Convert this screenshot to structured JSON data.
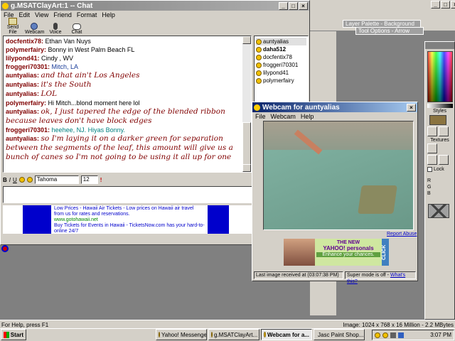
{
  "chat": {
    "title": "g.MSATClayArt:1 -- Chat",
    "menu": [
      "File",
      "Edit",
      "View",
      "Friend",
      "Format",
      "Help"
    ],
    "toolbar": [
      "Send File",
      "Webcam",
      "Voice",
      "Chat"
    ],
    "messages": [
      {
        "name": "docfentix78:",
        "text": "Ethan Van Nuys",
        "style": "plain"
      },
      {
        "name": "polymerfairy:",
        "text": "Bonny in West Palm Beach FL",
        "style": "plain"
      },
      {
        "name": "lilypond41:",
        "text": "Cindy , WV",
        "style": "plain"
      },
      {
        "name": "froggeri70301:",
        "text": "Mitch, LA",
        "style": "green"
      },
      {
        "name": "auntyalias:",
        "text": "and that ain't Los Angeles",
        "style": "script"
      },
      {
        "name": "auntyalias:",
        "text": "it's the South",
        "style": "script"
      },
      {
        "name": "auntyalias:",
        "text": "LOL",
        "style": "script"
      },
      {
        "name": "polymerfairy:",
        "text": "Hi Mitch...blond moment here lol",
        "style": "plain"
      },
      {
        "name": "auntyalias:",
        "text": "ok, I just tapered the edge of the blended ribbon because leaves don't have block edges",
        "style": "script"
      },
      {
        "name": "froggeri70301:",
        "text": "heehee, NJ. Hiyas Bonny.",
        "style": "green"
      },
      {
        "name": "auntyalias:",
        "text": "so I'm laying it on a darker green for separation between the segments of the leaf, this amount will give us a bunch of canes so I'm not going to be using it all up for one",
        "style": "script"
      }
    ],
    "users": [
      "auntyalias",
      "daha512",
      "docfentix78",
      "froggeri70301",
      "lilypond41",
      "polymerfairy"
    ],
    "font": "Tahoma",
    "size": "12",
    "ads": [
      "Low Prices - Hawaii Air Tickets - Low prices on Hawaii air travel from us for rates and reservations.",
      "www.gotohawaii.net",
      "Buy Tickets for Events in Hawaii - TicketsNow.com has your hard-to-online 24/7"
    ]
  },
  "webcam": {
    "title": "Webcam for auntyalias",
    "menu": [
      "File",
      "Webcam",
      "Help"
    ],
    "report": "Report Abuse",
    "ad": {
      "line1": "THE NEW",
      "line2": "YAHOO! personals",
      "line3": "Enhance your chances.",
      "click": "CLICK"
    },
    "status": "Last image received at (03:07:38 PM)",
    "super": "Super mode is off - ",
    "whats": "What's this?"
  },
  "psp": {
    "layer_palette": "Layer Palette - Background",
    "tool_options": "Tool Options - Arrow",
    "styles": "Styles",
    "textures": "Textures",
    "lock": "Lock",
    "r": "R",
    "g": "G",
    "b": "B"
  },
  "status": {
    "left": "For Help, press F1",
    "right": "Image:  1024 x 768 x 16 Million - 2.2 MBytes"
  },
  "taskbar": {
    "start": "Start",
    "items": [
      "Yahoo! Messenger",
      "g.MSATClayArt...",
      "Webcam for a...",
      "Jasc Paint Shop..."
    ],
    "clock": "3:07 PM"
  }
}
